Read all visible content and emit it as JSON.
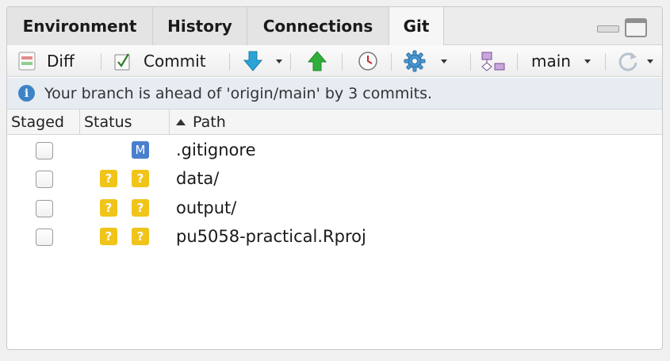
{
  "tabs": [
    {
      "label": "Environment",
      "active": false
    },
    {
      "label": "History",
      "active": false
    },
    {
      "label": "Connections",
      "active": false
    },
    {
      "label": "Git",
      "active": true
    }
  ],
  "toolbar": {
    "diff_label": "Diff",
    "commit_label": "Commit",
    "branch_label": "main",
    "icons": [
      "diff-icon",
      "commit-icon",
      "pull-icon",
      "push-icon",
      "history-icon",
      "gear-icon",
      "new-branch-icon",
      "refresh-icon"
    ]
  },
  "info": {
    "message": "Your branch is ahead of 'origin/main' by 3 commits."
  },
  "columns": {
    "staged": "Staged",
    "status": "Status",
    "path": "Path"
  },
  "files": [
    {
      "staged": false,
      "status_index": "",
      "status_worktree": "M",
      "path": ".gitignore"
    },
    {
      "staged": false,
      "status_index": "?",
      "status_worktree": "?",
      "path": "data/"
    },
    {
      "staged": false,
      "status_index": "?",
      "status_worktree": "?",
      "path": "output/"
    },
    {
      "staged": false,
      "status_index": "?",
      "status_worktree": "?",
      "path": "pu5058-practical.Rproj"
    }
  ],
  "colors": {
    "untracked_badge": "#f0c419",
    "modified_badge": "#4a7fcf",
    "info_bar": "#e6ecf2",
    "info_icon": "#3d84c6",
    "pull_arrow": "#2ba3d6",
    "push_arrow": "#2fae3a"
  }
}
